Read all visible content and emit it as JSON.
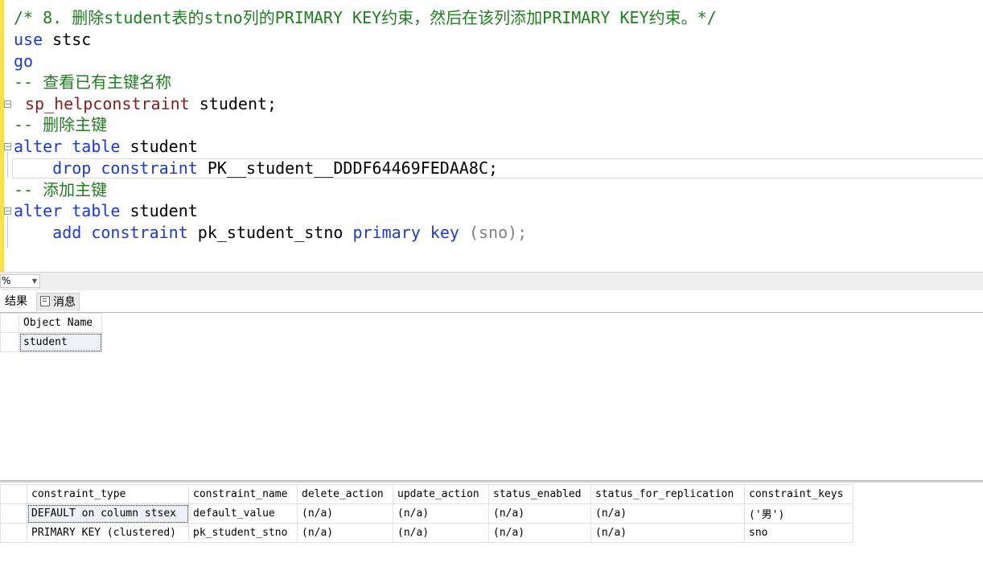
{
  "editor": {
    "lines": [
      {
        "t": "/* 8. 删除student表的stno列的PRIMARY KEY约束，然后在该列添加PRIMARY KEY约束。*/"
      },
      {
        "a": "use",
        "b": " stsc"
      },
      {
        "a": "go"
      },
      {
        "t": "-- 查看已有主键名称"
      },
      {
        "a": "sp_helpconstraint",
        "b": " student;"
      },
      {
        "t": "-- 删除主键"
      },
      {
        "a": "alter table",
        "b": " student"
      },
      {
        "a": "    drop constraint",
        "b": " PK__student__DDDF64469FEDAA8C;"
      },
      {
        "t": "-- 添加主键"
      },
      {
        "a": "alter table",
        "b": " student"
      },
      {
        "a": "    add constraint",
        "b": " pk_student_stno ",
        "c": "primary key",
        "d": " (sno);"
      }
    ]
  },
  "zoom": {
    "value": "%"
  },
  "tabs": {
    "results": "结果",
    "messages": "消息"
  },
  "grid1": {
    "header": "Object Name",
    "value": "student"
  },
  "grid2": {
    "headers": [
      "constraint_type",
      "constraint_name",
      "delete_action",
      "update_action",
      "status_enabled",
      "status_for_replication",
      "constraint_keys"
    ],
    "rows": [
      [
        "DEFAULT on column stsex",
        "default_value",
        "(n/a)",
        "(n/a)",
        "(n/a)",
        "(n/a)",
        "('男')"
      ],
      [
        "PRIMARY KEY (clustered)",
        "pk_student_stno",
        "(n/a)",
        "(n/a)",
        "(n/a)",
        "(n/a)",
        "sno"
      ]
    ]
  }
}
